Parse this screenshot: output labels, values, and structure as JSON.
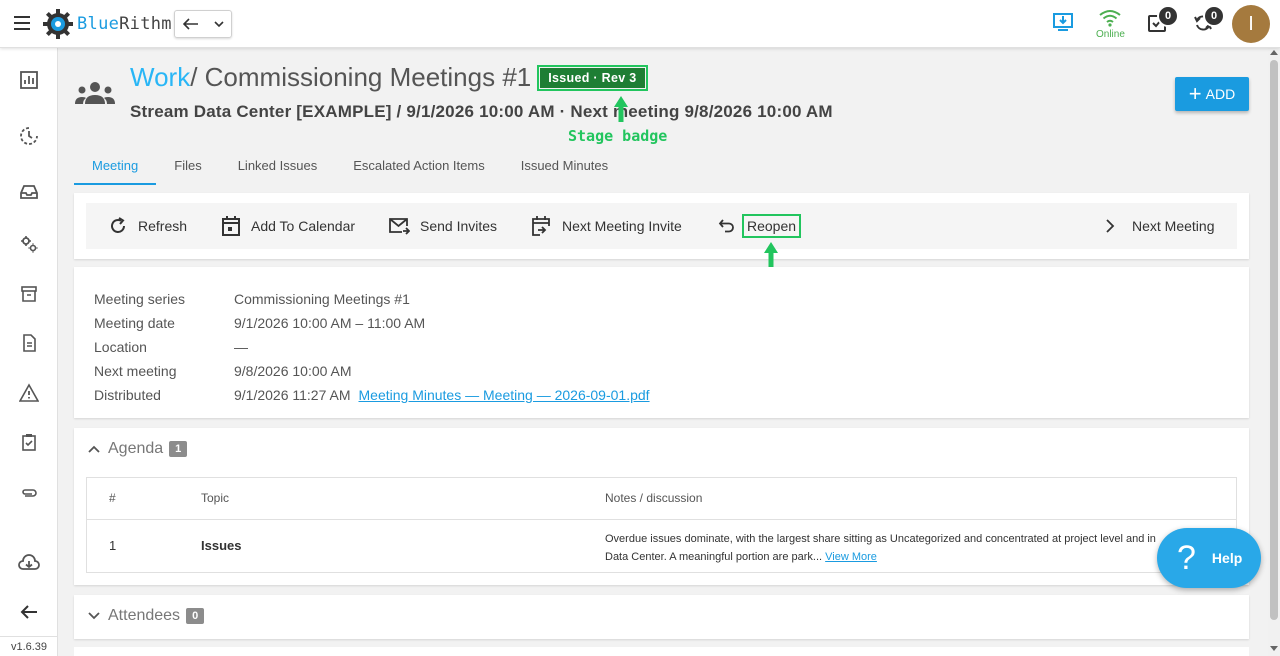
{
  "app": {
    "logo_prefix": "Blue",
    "logo_suffix": "Rithm",
    "online_label": "Online",
    "tasks_count": "0",
    "sync_count": "0",
    "avatar_initial": "I",
    "version": "v1.6.39"
  },
  "header": {
    "breadcrumb_link": "Work",
    "title_rest": " / Commissioning Meetings #1",
    "stage_badge": "Issued · Rev 3",
    "subtitle": "Stream Data Center [EXAMPLE] / 9/1/2026 10:00 AM · Next meeting 9/8/2026 10:00 AM",
    "add_label": "ADD",
    "stage_annotation": "Stage badge"
  },
  "tabs": [
    "Meeting",
    "Files",
    "Linked Issues",
    "Escalated Action Items",
    "Issued Minutes"
  ],
  "toolbar": {
    "refresh": "Refresh",
    "add_to_calendar": "Add To Calendar",
    "send_invites": "Send Invites",
    "next_meeting_invite": "Next Meeting Invite",
    "reopen": "Reopen",
    "next_meeting": "Next Meeting"
  },
  "details": {
    "series_label": "Meeting series",
    "series_value": "Commissioning Meetings #1",
    "date_label": "Meeting date",
    "date_value": "9/1/2026 10:00 AM – 11:00 AM",
    "location_label": "Location",
    "location_value": "—",
    "next_label": "Next meeting",
    "next_value": "9/8/2026 10:00 AM",
    "distributed_label": "Distributed",
    "distributed_value": "9/1/2026 11:27 AM",
    "distributed_link": "Meeting Minutes — Meeting — 2026-09-01.pdf"
  },
  "agenda": {
    "title": "Agenda",
    "count": "1",
    "col_num": "#",
    "col_topic": "Topic",
    "col_notes": "Notes / discussion",
    "rows": [
      {
        "num": "1",
        "topic": "Issues",
        "notes_line1": "Overdue issues dominate, with the largest share sitting as Uncategorized and concentrated at project level and in",
        "notes_line2": "Data Center. A meaningful portion are park...",
        "view_more": "View More"
      }
    ]
  },
  "attendees": {
    "title": "Attendees",
    "count": "0"
  },
  "help": {
    "label": "Help"
  },
  "colors": {
    "accent": "#1a9be0",
    "stage_badge": "#1e7e34",
    "annotation": "#22c55e"
  }
}
